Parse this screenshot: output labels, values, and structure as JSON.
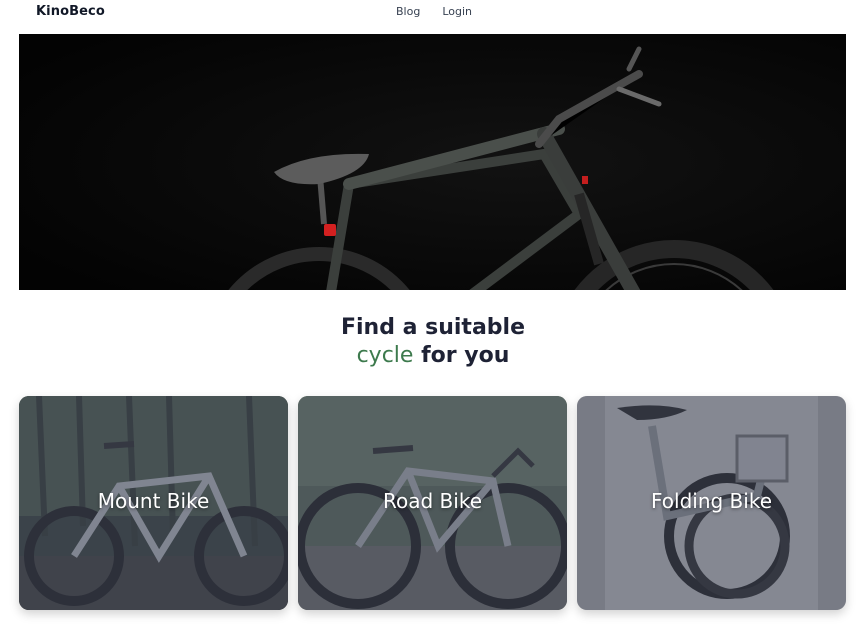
{
  "brand": {
    "name": "KinoBeco"
  },
  "nav": {
    "links": [
      {
        "label": "Blog"
      },
      {
        "label": "Login"
      }
    ]
  },
  "hero": {
    "image": "black-mountain-bike-photo"
  },
  "heading": {
    "line1": "Find a suitable",
    "accent": "cycle",
    "rest": " for you"
  },
  "categories": [
    {
      "label": "Mount Bike",
      "image": "mountain-bike-forest-photo"
    },
    {
      "label": "Road Bike",
      "image": "road-bike-park-photo"
    },
    {
      "label": "Folding Bike",
      "image": "folding-bike-studio-photo"
    }
  ],
  "colors": {
    "accent": "#3d7a4d",
    "heading": "#1e2235",
    "overlay": "#464a5c"
  }
}
